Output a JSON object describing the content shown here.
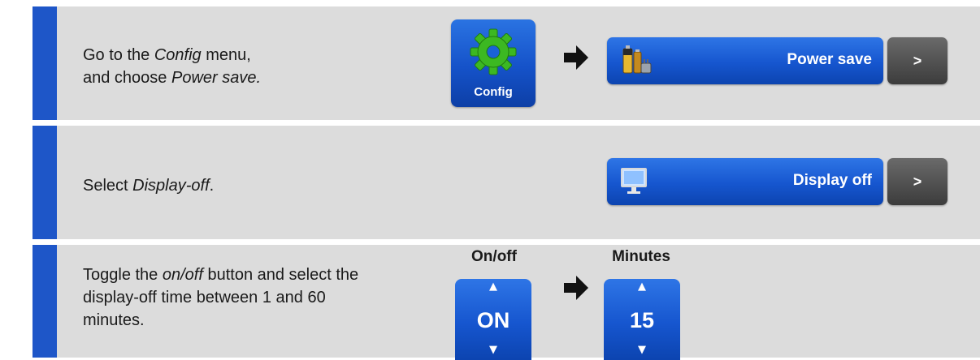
{
  "steps": [
    {
      "text_parts": [
        "Go to the ",
        "Config",
        " menu,",
        "and choose ",
        "Power save."
      ],
      "config_tile": {
        "label": "Config",
        "icon": "gear-icon"
      },
      "menu_item": {
        "label": "Power save",
        "icon": "battery-plug-icon",
        "go_label": ">"
      }
    },
    {
      "text_parts": [
        "Select ",
        "Display-off",
        "."
      ],
      "menu_item": {
        "label": "Display off",
        "icon": "monitor-icon",
        "go_label": ">"
      }
    },
    {
      "text_parts": [
        "Toggle the ",
        "on/off",
        " button and select the",
        "display-off time between 1 and 60",
        "minutes."
      ],
      "onoff": {
        "title": "On/off",
        "value": "ON"
      },
      "minutes": {
        "title": "Minutes",
        "value": "15"
      }
    }
  ],
  "colors": {
    "accent_bar": "#1e56c8",
    "row_bg": "#dcdcdc",
    "button_blue": "#1656cf",
    "go_grey": "#4a4a4a",
    "gear_green": "#3cb822"
  }
}
